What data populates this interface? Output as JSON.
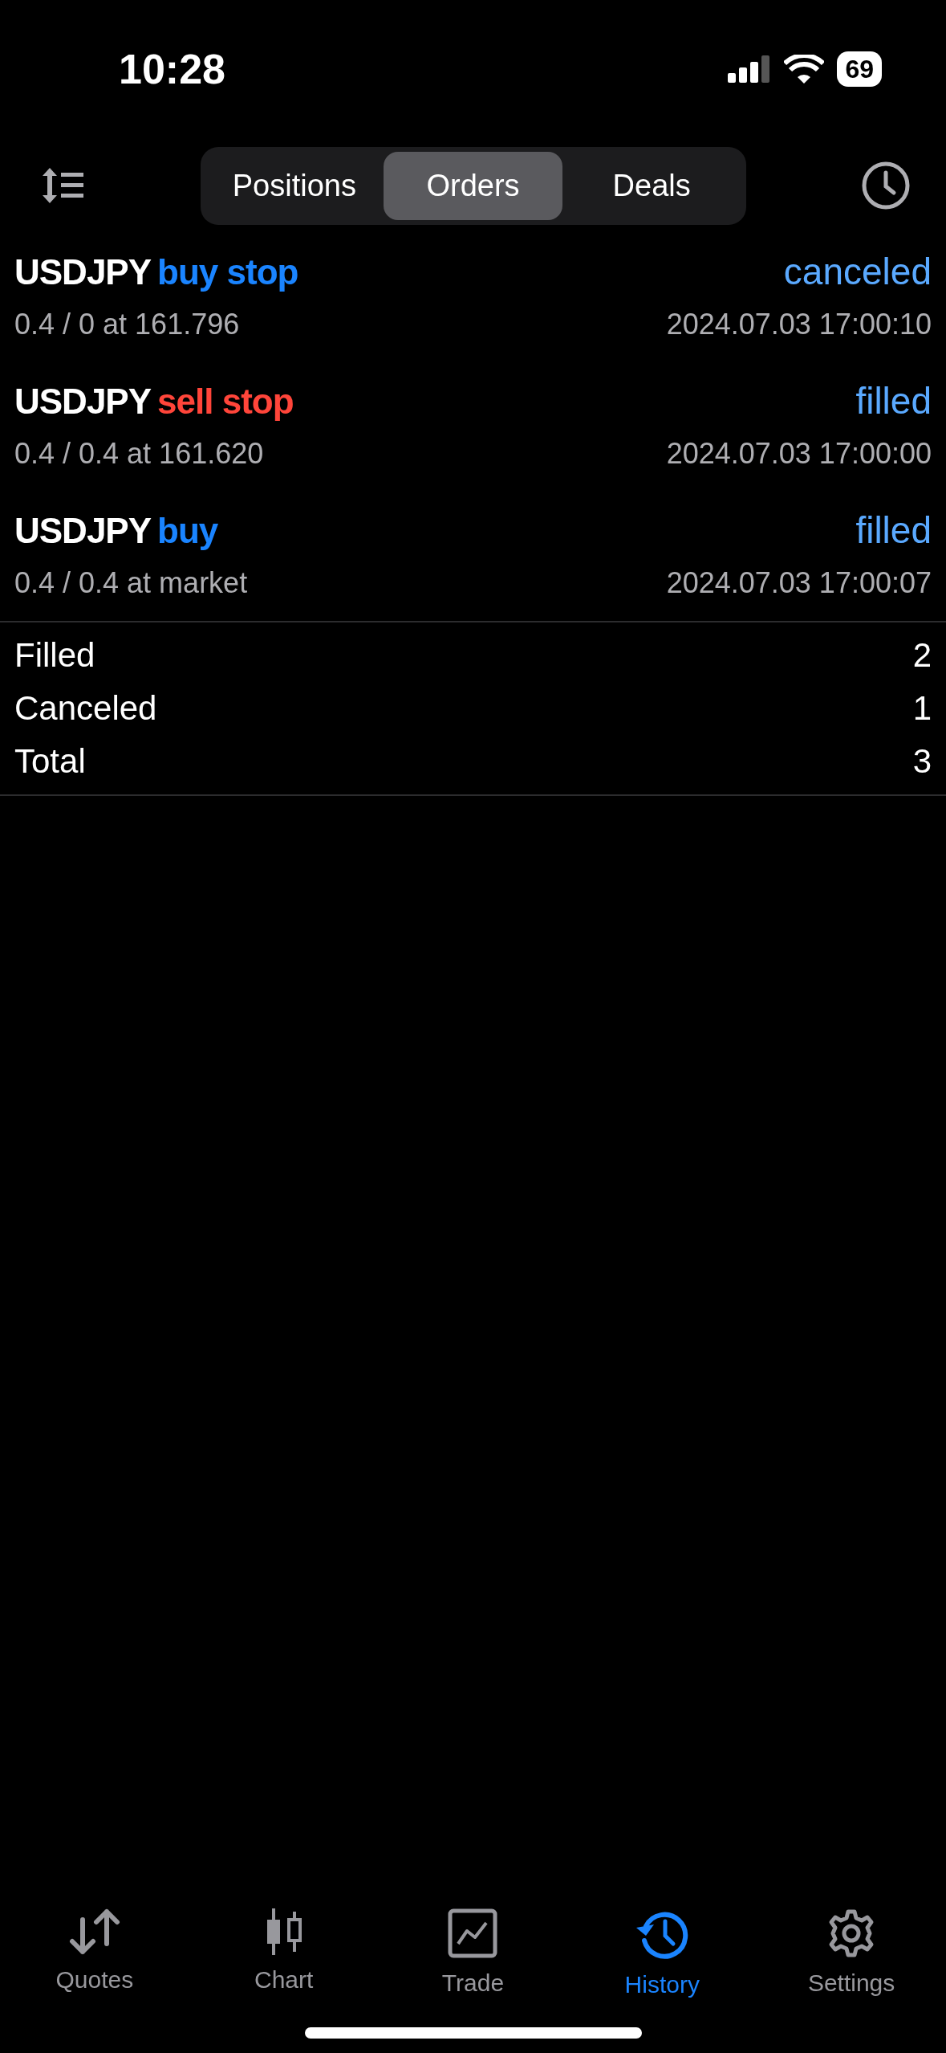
{
  "status_bar": {
    "time": "10:28",
    "battery": "69"
  },
  "segments": [
    {
      "label": "Positions",
      "selected": false
    },
    {
      "label": "Orders",
      "selected": true
    },
    {
      "label": "Deals",
      "selected": false
    }
  ],
  "orders": [
    {
      "symbol": "USDJPY",
      "type": "buy stop",
      "color": "#1a84ff",
      "status": "canceled",
      "detail": "0.4 / 0 at 161.796",
      "time": "2024.07.03 17:00:10"
    },
    {
      "symbol": "USDJPY",
      "type": "sell stop",
      "color": "#ff453a",
      "status": "filled",
      "detail": "0.4 / 0.4 at 161.620",
      "time": "2024.07.03 17:00:00"
    },
    {
      "symbol": "USDJPY",
      "type": "buy",
      "color": "#1a84ff",
      "status": "filled",
      "detail": "0.4 / 0.4 at market",
      "time": "2024.07.03 17:00:07"
    }
  ],
  "summary": [
    {
      "label": "Filled",
      "value": "2"
    },
    {
      "label": "Canceled",
      "value": "1"
    },
    {
      "label": "Total",
      "value": "3"
    }
  ],
  "tab_bar": [
    {
      "label": "Quotes",
      "kind": "quotes",
      "selected": false
    },
    {
      "label": "Chart",
      "kind": "chart",
      "selected": false
    },
    {
      "label": "Trade",
      "kind": "trade",
      "selected": false
    },
    {
      "label": "History",
      "kind": "history",
      "selected": true
    },
    {
      "label": "Settings",
      "kind": "settings",
      "selected": false
    }
  ]
}
